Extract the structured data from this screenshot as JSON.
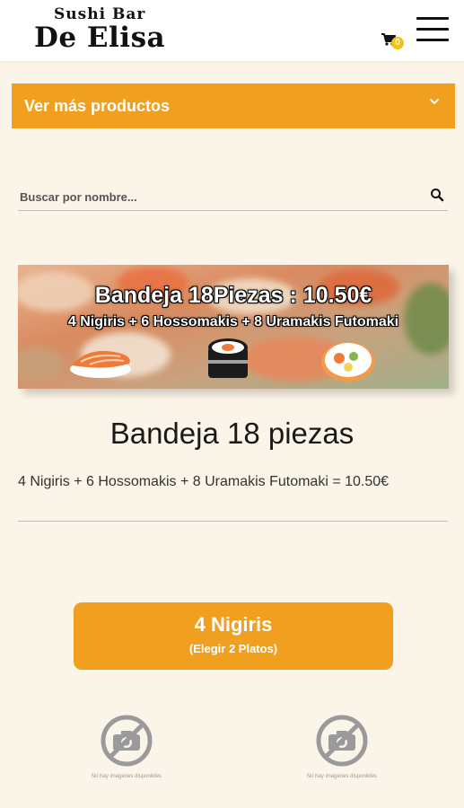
{
  "header": {
    "logo_top": "Sushi Bar",
    "logo_main": "De Elisa",
    "cart_count": "0"
  },
  "category_dropdown": {
    "label": "Ver más productos"
  },
  "search": {
    "placeholder": "Buscar por nombre..."
  },
  "banner": {
    "title": "Bandeja 18Piezas : 10.50€",
    "subtitle": "4 Nigiris + 6 Hossomakis + 8 Uramakis Futomaki"
  },
  "product": {
    "title": "Bandeja 18 piezas",
    "description": "4 Nigiris + 6 Hossomakis + 8 Uramakis Futomaki = 10.50€"
  },
  "option": {
    "title": "4 Nigiris",
    "subtitle": "(Elegir 2 Platos)"
  },
  "no_image_items": [
    {
      "caption": "No hay imagenes disponibles"
    },
    {
      "caption": "No hay imagenes disponibles"
    }
  ],
  "colors": {
    "accent": "#f0a01e",
    "background": "#fbf4e8",
    "badge": "#f2c40f"
  }
}
